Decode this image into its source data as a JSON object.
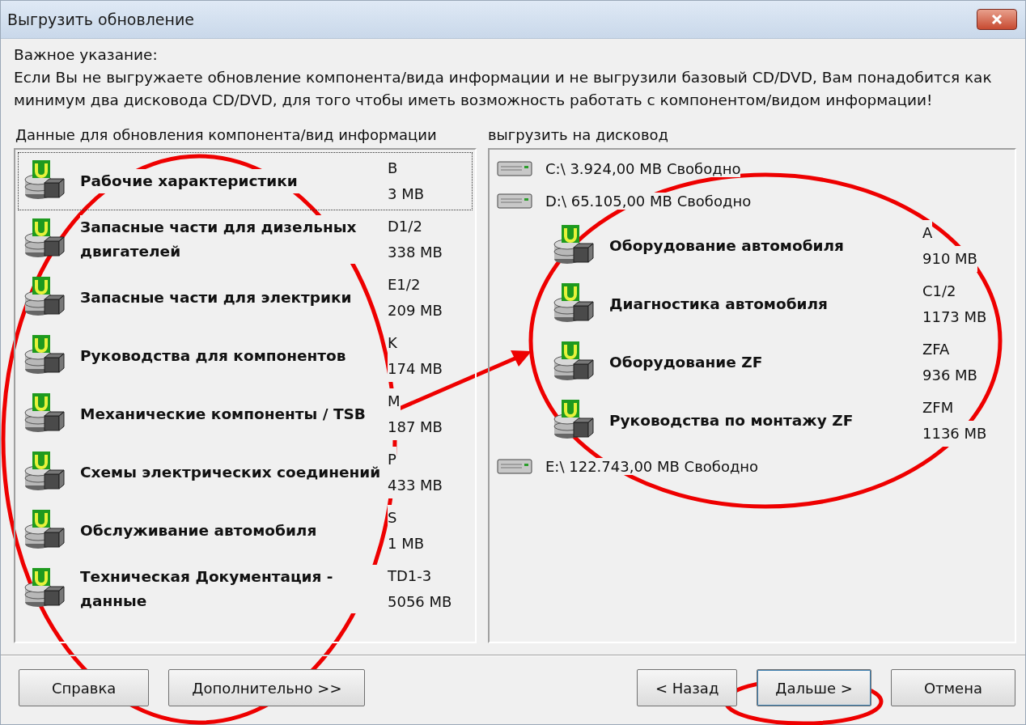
{
  "window": {
    "title": "Выгрузить обновление"
  },
  "notice": {
    "heading": "Важное указание:",
    "text": "Если Вы не выгружаете обновление компонента/вида информации и не выгрузили базовый CD/DVD, Вам понадобится как минимум два дисковода CD/DVD, для того чтобы иметь возможность работать с компонентом/видом информации!"
  },
  "source_list": {
    "label": "Данные для обновления компонента/вид информации",
    "items": [
      {
        "name": "Рабочие характеристики",
        "code": "B",
        "size": "3 MB",
        "selected": true
      },
      {
        "name": "Запасные части для дизельных двигателей",
        "code": "D1/2",
        "size": "338 MB",
        "selected": false
      },
      {
        "name": "Запасные части для электрики",
        "code": "E1/2",
        "size": "209 MB",
        "selected": false
      },
      {
        "name": "Руководства для компонентов",
        "code": "K",
        "size": "174 MB",
        "selected": false
      },
      {
        "name": "Механические компоненты / TSB",
        "code": "M",
        "size": "187 MB",
        "selected": false
      },
      {
        "name": "Схемы электрических соединений",
        "code": "P",
        "size": "433 MB",
        "selected": false
      },
      {
        "name": "Обслуживание автомобиля",
        "code": "S",
        "size": "1 MB",
        "selected": false
      },
      {
        "name": "Техническая Документация - данные",
        "code": "TD1-3",
        "size": "5056 MB",
        "selected": false
      }
    ]
  },
  "target_list": {
    "label": "выгрузить на дисковод",
    "drives": [
      {
        "label": "C:\\ 3.924,00 MB Свободно"
      },
      {
        "label": "D:\\ 65.105,00 MB Свободно",
        "children": [
          {
            "name": "Оборудование автомобиля",
            "code": "A",
            "size": "910 MB"
          },
          {
            "name": "Диагностика автомобиля",
            "code": "C1/2",
            "size": "1173 MB"
          },
          {
            "name": "Оборудование ZF",
            "code": "ZFA",
            "size": "936 MB"
          },
          {
            "name": "Руководства по монтажу ZF",
            "code": "ZFM",
            "size": "1136 MB"
          }
        ]
      },
      {
        "label": "E:\\ 122.743,00 MB Свободно"
      }
    ]
  },
  "buttons_left": [
    "Справка",
    "Дополнительно >>"
  ],
  "buttons_right": [
    {
      "label": "< Назад",
      "highlighted": false
    },
    {
      "label": "Дальше >",
      "highlighted": true
    },
    {
      "label": "Отмена",
      "highlighted": false
    }
  ]
}
